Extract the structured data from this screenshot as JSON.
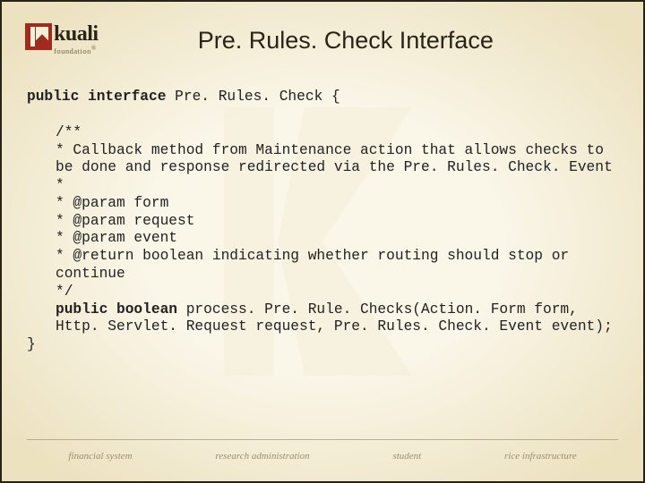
{
  "logo": {
    "name": "kuali",
    "sub": "foundation"
  },
  "title": "Pre. Rules. Check Interface",
  "code": {
    "line_decl_pre": "public interface ",
    "line_decl_post": "Pre. Rules. Check {",
    "doc_open": "/**",
    "doc_desc": " * Callback method from Maintenance action that allows checks to be done and response redirected via the Pre. Rules. Check. Event",
    "doc_blank": " *",
    "doc_p1": " * @param form",
    "doc_p2": " * @param request",
    "doc_p3": " * @param event",
    "doc_ret": " * @return boolean indicating whether routing should stop or continue",
    "doc_close": " */",
    "method_pre": "public boolean ",
    "method_post": "process. Pre. Rule. Checks(Action. Form form, Http. Servlet. Request request, Pre. Rules. Check. Event event);",
    "close_brace": "}"
  },
  "footer": {
    "col1": "financial system",
    "col2": "research administration",
    "col3": "student",
    "col4": "rice infrastructure"
  }
}
